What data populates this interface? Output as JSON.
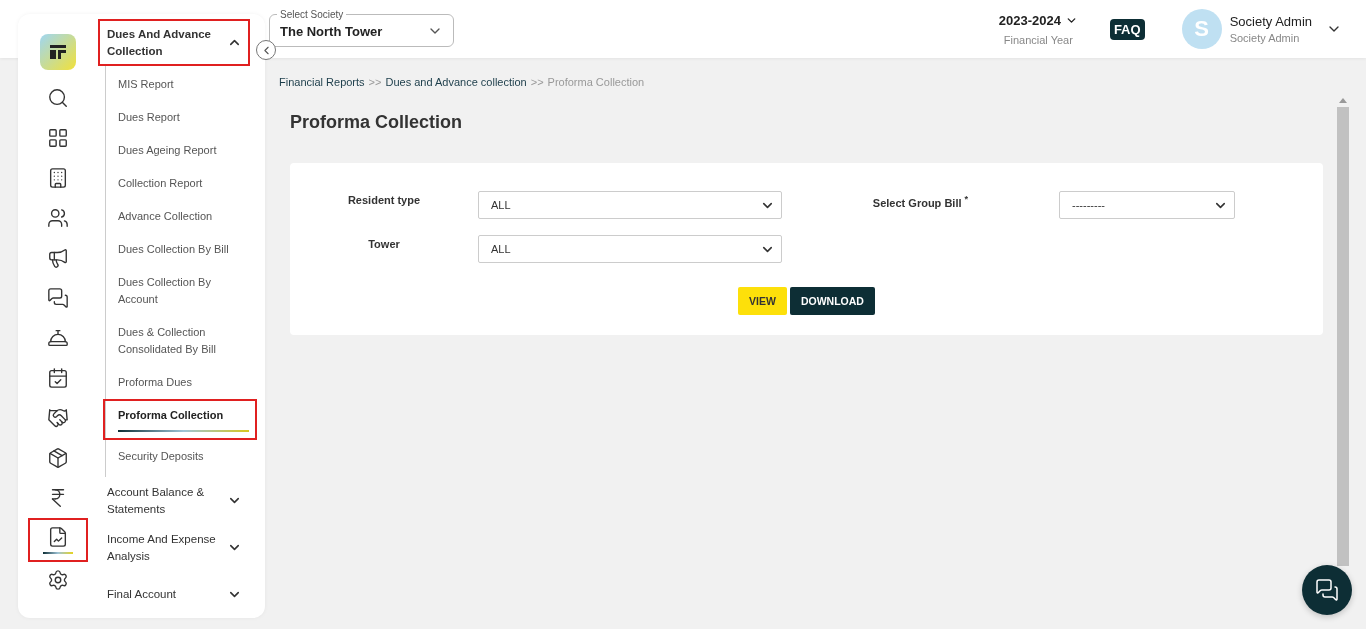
{
  "rail": [
    {
      "kind": "search",
      "selected": false,
      "highlighted": false
    },
    {
      "kind": "dashboard",
      "selected": false,
      "highlighted": false
    },
    {
      "kind": "building",
      "selected": false,
      "highlighted": false
    },
    {
      "kind": "people",
      "selected": false,
      "highlighted": false
    },
    {
      "kind": "megaphone",
      "selected": false,
      "highlighted": false
    },
    {
      "kind": "chat",
      "selected": false,
      "highlighted": false
    },
    {
      "kind": "desk",
      "selected": false,
      "highlighted": false
    },
    {
      "kind": "calendar",
      "selected": false,
      "highlighted": false
    },
    {
      "kind": "handshake",
      "selected": false,
      "highlighted": false
    },
    {
      "kind": "box",
      "selected": false,
      "highlighted": false
    },
    {
      "kind": "rupee",
      "selected": false,
      "highlighted": false
    },
    {
      "kind": "report",
      "selected": true,
      "highlighted": true
    },
    {
      "kind": "settings",
      "selected": false,
      "highlighted": false
    }
  ],
  "menu": [
    {
      "label": "Dues And Advance Collection",
      "expanded": true,
      "highlighted": true,
      "children": [
        {
          "label": "MIS Report",
          "selected": false,
          "highlighted": false
        },
        {
          "label": "Dues Report",
          "selected": false,
          "highlighted": false
        },
        {
          "label": "Dues Ageing Report",
          "selected": false,
          "highlighted": false
        },
        {
          "label": "Collection Report",
          "selected": false,
          "highlighted": false
        },
        {
          "label": "Advance Collection",
          "selected": false,
          "highlighted": false
        },
        {
          "label": "Dues Collection By Bill",
          "selected": false,
          "highlighted": false
        },
        {
          "label": "Dues Collection By Account",
          "selected": false,
          "highlighted": false
        },
        {
          "label": "Dues & Collection Consolidated By Bill",
          "selected": false,
          "highlighted": false
        },
        {
          "label": "Proforma Dues",
          "selected": false,
          "highlighted": false
        },
        {
          "label": "Proforma Collection",
          "selected": true,
          "highlighted": true
        },
        {
          "label": "Security Deposits",
          "selected": false,
          "highlighted": false
        }
      ]
    },
    {
      "label": "Account Balance & Statements",
      "expanded": false,
      "highlighted": false
    },
    {
      "label": "Income And Expense Analysis",
      "expanded": false,
      "highlighted": false
    },
    {
      "label": "Final Account",
      "expanded": false,
      "highlighted": false
    }
  ],
  "header": {
    "society": {
      "label": "Select Society",
      "value": "The North Tower"
    },
    "year": {
      "value": "2023-2024",
      "caption": "Financial Year"
    },
    "faq": "FAQ",
    "user": {
      "initial": "S",
      "name": "Society Admin",
      "role": "Society Admin"
    }
  },
  "breadcrumb": [
    {
      "kind": "link",
      "text": "Financial Reports"
    },
    {
      "kind": "separator",
      "text": ">>"
    },
    {
      "kind": "link",
      "text": "Dues and Advance collection"
    },
    {
      "kind": "separator",
      "text": ">>"
    },
    {
      "kind": "current",
      "text": "Proforma Collection"
    }
  ],
  "title": "Proforma Collection",
  "form": {
    "fields": [
      {
        "label": "Resident type",
        "value": "ALL"
      },
      {
        "label": "Select Group Bill $^{*}$",
        "value": "---------"
      },
      {
        "label": "Tower",
        "value": "ALL"
      }
    ],
    "buttons": [
      {
        "kind": "primary",
        "label": "VIEW"
      },
      {
        "kind": "dark",
        "label": "DOWNLOAD"
      }
    ]
  }
}
